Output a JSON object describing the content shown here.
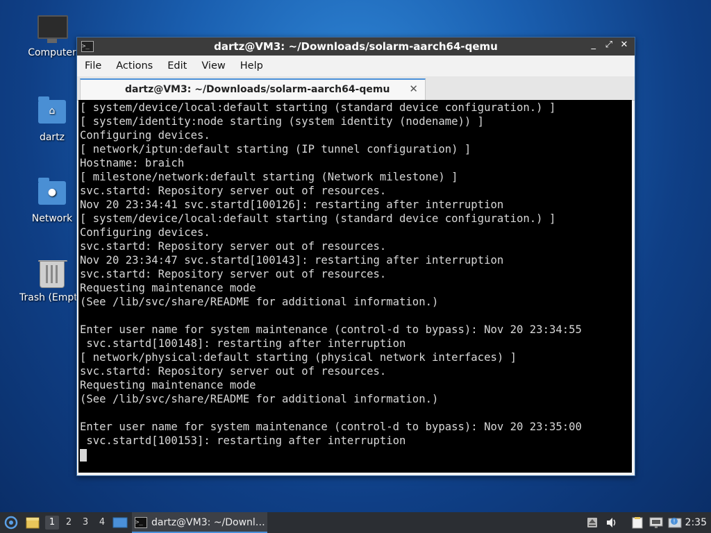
{
  "desktop": {
    "icons": [
      {
        "label": "Computer"
      },
      {
        "label": "dartz"
      },
      {
        "label": "Network"
      },
      {
        "label": "Trash (Empty)"
      }
    ]
  },
  "window": {
    "title": "dartz@VM3: ~/Downloads/solarm-aarch64-qemu",
    "controls": {
      "minimize": "_",
      "maximize": "⤢",
      "close": "✕"
    },
    "menu": [
      "File",
      "Actions",
      "Edit",
      "View",
      "Help"
    ],
    "tab": {
      "label": "dartz@VM3: ~/Downloads/solarm-aarch64-qemu",
      "close": "✕"
    },
    "terminal_lines": [
      "[ system/device/local:default starting (standard device configuration.) ]",
      "[ system/identity:node starting (system identity (nodename)) ]",
      "Configuring devices.",
      "[ network/iptun:default starting (IP tunnel configuration) ]",
      "Hostname: braich",
      "[ milestone/network:default starting (Network milestone) ]",
      "svc.startd: Repository server out of resources.",
      "Nov 20 23:34:41 svc.startd[100126]: restarting after interruption",
      "[ system/device/local:default starting (standard device configuration.) ]",
      "Configuring devices.",
      "svc.startd: Repository server out of resources.",
      "Nov 20 23:34:47 svc.startd[100143]: restarting after interruption",
      "svc.startd: Repository server out of resources.",
      "Requesting maintenance mode",
      "(See /lib/svc/share/README for additional information.)",
      "",
      "Enter user name for system maintenance (control-d to bypass): Nov 20 23:34:55",
      " svc.startd[100148]: restarting after interruption",
      "[ network/physical:default starting (physical network interfaces) ]",
      "svc.startd: Repository server out of resources.",
      "Requesting maintenance mode",
      "(See /lib/svc/share/README for additional information.)",
      "",
      "Enter user name for system maintenance (control-d to bypass): Nov 20 23:35:00",
      " svc.startd[100153]: restarting after interruption"
    ]
  },
  "taskbar": {
    "workspaces": [
      "1",
      "2",
      "3",
      "4"
    ],
    "active_workspace": "1",
    "task_label": "dartz@VM3: ~/Downl…",
    "clock": "2:35",
    "icons": [
      "start-menu-icon",
      "file-manager-icon",
      "show-desktop-icon",
      "terminal-icon",
      "eject-icon",
      "volume-icon",
      "clipboard-icon",
      "network-icon",
      "update-notifier-icon"
    ]
  },
  "colors": {
    "accent": "#4a90d9",
    "terminal_bg": "#000000",
    "terminal_fg": "#d8d8d8"
  }
}
